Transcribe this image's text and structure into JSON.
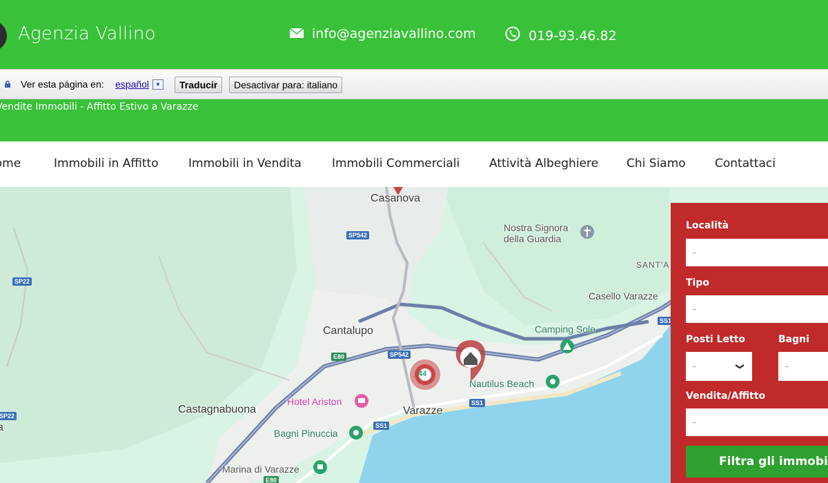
{
  "header": {
    "brand": "Agenzia Vallino",
    "email": "info@agenziavallino.com",
    "phone": "019-93.46.82"
  },
  "translate_bar": {
    "label": "Ver esta página en:",
    "language": "español",
    "translate_button": "Traducir",
    "disable_button": "Desactivar para: italiano"
  },
  "tagline": "Vendite Immobili - Affitto Estivo a Varazze",
  "nav": {
    "items": [
      {
        "label": "Home"
      },
      {
        "label": "Immobili in Affitto"
      },
      {
        "label": "Immobili in Vendita"
      },
      {
        "label": "Immobili Commerciali"
      },
      {
        "label": "Attività Albeghiere"
      },
      {
        "label": "Chi Siamo"
      },
      {
        "label": "Contattaci"
      }
    ]
  },
  "map": {
    "places": [
      "Casanova",
      "Nostra Signora della Guardia",
      "SANT'A",
      "Casello Varazze",
      "Cantalupo",
      "Camping Sole",
      "Nautilus Beach",
      "Castagnabuona",
      "Hotel Ariston",
      "Varazze",
      "Bagni Pinuccia",
      "Marina di Varazze",
      "a"
    ],
    "roads": [
      "SP542",
      "SP542",
      "SP22",
      "SP22",
      "E80",
      "E80",
      "SS1",
      "SS1",
      "SS1"
    ],
    "cluster_count": "44"
  },
  "filter": {
    "location_label": "Località",
    "location_value": "-",
    "type_label": "Tipo",
    "type_value": "-",
    "beds_label": "Posti Letto",
    "beds_value": "-",
    "baths_label": "Bagni",
    "baths_value": "-",
    "sale_rent_label": "Vendita/Affitto",
    "sale_rent_value": "-",
    "submit_label": "Filtra gli immobili"
  },
  "colors": {
    "header_green": "#39c139",
    "filter_red": "#c12a2a",
    "button_green": "#2ea12e",
    "map_land": "#d9f3e4",
    "map_sea": "#8fd4ec"
  }
}
